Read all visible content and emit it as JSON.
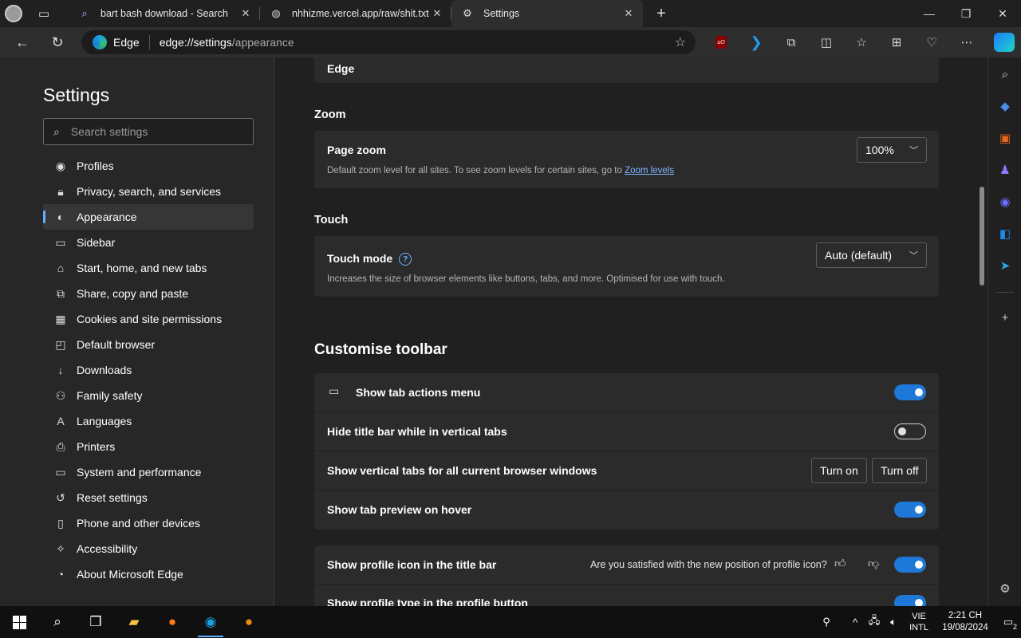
{
  "tabs": [
    {
      "label": "bart bash download - Search",
      "icon": "search-icon"
    },
    {
      "label": "nhhizme.vercel.app/raw/shit.txt",
      "icon": "globe-icon"
    },
    {
      "label": "Settings",
      "icon": "gear-icon",
      "active": true
    }
  ],
  "address": {
    "brand": "Edge",
    "url_host": "edge://settings",
    "url_path": "/appearance"
  },
  "sidebar": {
    "title": "Settings",
    "search_placeholder": "Search settings",
    "items": [
      {
        "label": "Profiles",
        "icon": "profile-icon"
      },
      {
        "label": "Privacy, search, and services",
        "icon": "lock-icon"
      },
      {
        "label": "Appearance",
        "icon": "palette-icon",
        "active": true
      },
      {
        "label": "Sidebar",
        "icon": "sidebar-icon"
      },
      {
        "label": "Start, home, and new tabs",
        "icon": "home-icon"
      },
      {
        "label": "Share, copy and paste",
        "icon": "share-icon"
      },
      {
        "label": "Cookies and site permissions",
        "icon": "cookie-icon"
      },
      {
        "label": "Default browser",
        "icon": "browser-icon"
      },
      {
        "label": "Downloads",
        "icon": "download-icon"
      },
      {
        "label": "Family safety",
        "icon": "family-icon"
      },
      {
        "label": "Languages",
        "icon": "language-icon"
      },
      {
        "label": "Printers",
        "icon": "printer-icon"
      },
      {
        "label": "System and performance",
        "icon": "laptop-icon"
      },
      {
        "label": "Reset settings",
        "icon": "reset-icon"
      },
      {
        "label": "Phone and other devices",
        "icon": "phone-icon"
      },
      {
        "label": "Accessibility",
        "icon": "accessibility-icon"
      },
      {
        "label": "About Microsoft Edge",
        "icon": "edge-icon"
      }
    ]
  },
  "main": {
    "partial_row_label": "Edge",
    "zoom": {
      "section": "Zoom",
      "title": "Page zoom",
      "desc": "Default zoom level for all sites. To see zoom levels for certain sites, go to ",
      "link": "Zoom levels",
      "value": "100%"
    },
    "touch": {
      "section": "Touch",
      "title": "Touch mode",
      "desc": "Increases the size of browser elements like buttons, tabs, and more. Optimised for use with touch.",
      "value": "Auto (default)"
    },
    "toolbar": {
      "section": "Customise toolbar",
      "rows": {
        "tab_actions": {
          "label": "Show tab actions menu",
          "on": true
        },
        "hide_title": {
          "label": "Hide title bar while in vertical tabs",
          "on": false
        },
        "vertical_tabs": {
          "label": "Show vertical tabs for all current browser windows",
          "turn_on": "Turn on",
          "turn_off": "Turn off"
        },
        "tab_preview": {
          "label": "Show tab preview on hover",
          "on": true
        }
      },
      "profile": {
        "label": "Show profile icon in the title bar",
        "feedback": "Are you satisfied with the new position of profile icon?",
        "on": true
      },
      "profile_type_partial": "Show profile type in the profile button"
    }
  },
  "taskbar": {
    "lang_line1": "VIE",
    "lang_line2": "INTL",
    "time": "2:21 CH",
    "date": "19/08/2024",
    "notifications": "2"
  },
  "colors": {
    "accent": "#1e78d8",
    "link": "#7fb8ff"
  }
}
